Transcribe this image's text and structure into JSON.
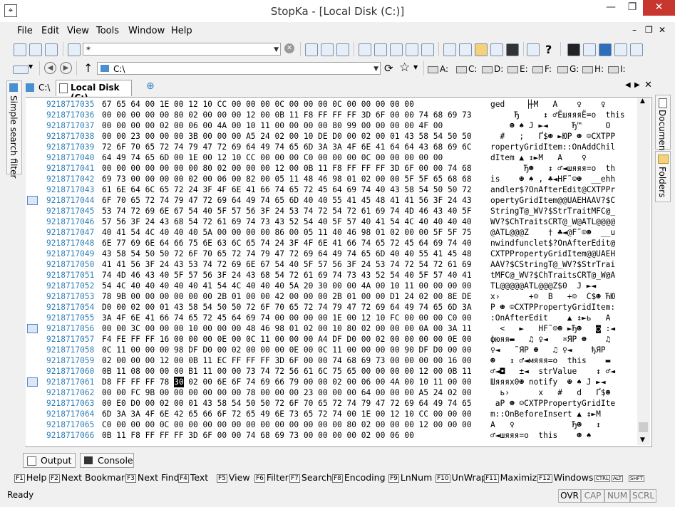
{
  "window": {
    "title": "StopKa - [Local Disk (C:)]"
  },
  "menu": [
    "File",
    "Edit",
    "View",
    "Tools",
    "Window",
    "Help"
  ],
  "toolbar1": {
    "filter_value": "*"
  },
  "toolbar2": {
    "path_value": "C:\\",
    "drives": [
      "A:",
      "C:",
      "D:",
      "E:",
      "F:",
      "G:",
      "H:",
      "I:"
    ]
  },
  "tabs": [
    {
      "label": "C:\\"
    },
    {
      "label": "Local Disk (C:)"
    }
  ],
  "side": {
    "left_panel": "Simple search filter",
    "right_panels": [
      "Document",
      "Folders"
    ]
  },
  "hex": {
    "rows": [
      {
        "offset": "9218717035",
        "hex": "67 65 64 00 1E 00 12 10 CC 00 00 00 0C 00 00 00 0C 00 00 00 00 00",
        "text": "ged    ▕┼M   A    ♀    ♀"
      },
      {
        "offset": "9218717036",
        "hex": "00 00 00 00 00 80 02 00 00 00 12 00 0B 11 F8 FF FF FF 3D 6F 00 00 74 68 69 73",
        "text": "     Ђ     ↕ ♂ЁшяяяЁ=o  this"
      },
      {
        "offset": "9218717037",
        "hex": "00 00 00 00 02 00 06 00 4A 00 10 11 00 00 00 00 80 99 00 00 00 00 4F 00",
        "text": "    ☻ ♠ J ►◄     Ђ™     O"
      },
      {
        "offset": "9218717038",
        "hex": "00 00 23 00 00 00 3B 00 00 00 A5 24 02 00 10 DE D0 00 02 00 01 43 58 54 50 50",
        "text": "  #   ;   Ґ$☻ ►ЮР ☻ ☺CXTPP"
      },
      {
        "offset": "9218717039",
        "hex": "72 6F 70 65 72 74 79 47 72 69 64 49 74 65 6D 3A 3A 4F 6E 41 64 64 43 68 69 6C",
        "text": "ropertyGridItem::OnAddChil"
      },
      {
        "offset": "9218717040",
        "hex": "64 49 74 65 6D 00 1E 00 12 10 CC 00 00 00 C0 00 00 00 0C 00 00 00 00 00",
        "text": "dItem ▲ ↕►M   A    ♀"
      },
      {
        "offset": "9218717041",
        "hex": "00 00 00 00 00 00 00 80 02 00 00 00 12 00 0B 11 F8 FF FF FF 3D 6F 00 00 74 68",
        "text": "       Ђ☻   ↕ ♂◄шяяя=o  th"
      },
      {
        "offset": "9218717042",
        "hex": "69 73 00 00 00 00 02 00 06 00 82 00 05 11 48 46 98 01 02 00 00 5F 5F 65 68 68",
        "text": "is    ☻ ♠ ‚ ♣◄HF˜☺☻  __ehh"
      },
      {
        "offset": "9218717043",
        "hex": "61 6E 64 6C 65 72 24 3F 4F 6E 41 66 74 65 72 45 64 69 74 40 43 58 54 50 50 72",
        "text": "andler$?OnAfterEdit@CXTPPr"
      },
      {
        "offset": "9218717044",
        "hex": "6F 70 65 72 74 79 47 72 69 64 49 74 65 6D 40 40 55 41 45 48 41 41 56 3F 24 43",
        "text": "opertyGridItem@@UAEHAAV?$C"
      },
      {
        "offset": "9218717045",
        "hex": "53 74 72 69 6E 67 54 40 5F 57 56 3F 24 53 74 72 54 72 61 69 74 4D 46 43 40 5F",
        "text": "StringT@_WV?$StrTraitMFC@_"
      },
      {
        "offset": "9218717046",
        "hex": "57 56 3F 24 43 68 54 72 61 69 74 73 43 52 54 40 5F 57 40 41 54 4C 40 40 40 40",
        "text": "WV?$ChTraitsCRT@_W@ATL@@@@"
      },
      {
        "offset": "9218717047",
        "hex": "40 41 54 4C 40 40 40 5A 00 00 00 00 86 00 05 11 40 46 98 01 02 00 00 5F 5F 75",
        "text": "@ATL@@@Z    † ♣◄@F˜☺☻  __u"
      },
      {
        "offset": "9218717048",
        "hex": "6E 77 69 6E 64 66 75 6E 63 6C 65 74 24 3F 4F 6E 41 66 74 65 72 45 64 69 74 40",
        "text": "nwindfunclet$?OnAfterEdit@"
      },
      {
        "offset": "9218717049",
        "hex": "43 58 54 50 50 72 6F 70 65 72 74 79 47 72 69 64 49 74 65 6D 40 40 55 41 45 48",
        "text": "CXTPPropertyGridItem@@UAEH"
      },
      {
        "offset": "9218717050",
        "hex": "41 41 56 3F 24 43 53 74 72 69 6E 67 54 40 5F 57 56 3F 24 53 74 72 54 72 61 69",
        "text": "AAV?$CStringT@_WV?$StrTrai"
      },
      {
        "offset": "9218717051",
        "hex": "74 4D 46 43 40 5F 57 56 3F 24 43 68 54 72 61 69 74 73 43 52 54 40 5F 57 40 41",
        "text": "tMFC@_WV?$ChTraitsCRT@_W@A"
      },
      {
        "offset": "9218717052",
        "hex": "54 4C 40 40 40 40 40 41 54 4C 40 40 40 5A 20 30 00 00 4A 00 10 11 00 00 00 00",
        "text": "TL@@@@@ATL@@@Z$0  J ►◄"
      },
      {
        "offset": "9218717053",
        "hex": "78 9B 00 00 00 00 00 00 2B 01 00 00 42 00 00 00 2B 01 00 00 D1 24 02 00 8E DE",
        "text": "x›      +☺  B   +☺  С$☻ ЋЮ"
      },
      {
        "offset": "9218717054",
        "hex": "D0 00 02 00 01 43 58 54 50 50 72 6F 70 65 72 74 79 47 72 69 64 49 74 65 6D 3A",
        "text": "Р ☻ ☺CXTPPropertyGridItem:"
      },
      {
        "offset": "9218717055",
        "hex": "3A 4F 6E 41 66 74 65 72 45 64 69 74 00 00 00 00 1E 00 12 10 FC 00 00 00 C0 00",
        "text": ":OnAfterEdit    ▲ ↕►ь   A"
      },
      {
        "offset": "9218717056",
        "hex": "00 00 3C 00 00 00 10 00 00 00 48 46 98 01 02 00 10 80 02 00 00 00 0A 00 3A 11",
        "text": "  <   ►   HF˜☺☻ ►Ђ☻   ◙ :◄"
      },
      {
        "offset": "9218717057",
        "hex": "F4 FE FF FF 16 00 00 00 0E 00 0C 11 00 00 00 A4 DF D0 00 02 00 00 00 00 0E 00",
        "text": "фюяя▬   ♫ ♀◄   ¤ЯР ☻    ♫"
      },
      {
        "offset": "9218717058",
        "hex": "0C 11 00 00 00 98 DF D0 00 02 00 00 00 0E 00 0C 11 00 00 00 00 90 DF D0 00 00",
        "text": "♀◄   ˜ЯР ☻   ♫ ♀◄    ђЯР"
      },
      {
        "offset": "9218717059",
        "hex": "02 00 00 00 12 00 0B 11 EC FF FF FF 3D 6F 00 00 74 68 69 73 00 00 00 00 16 00",
        "text": "☻   ↕ ♂◄мяяя=o  this    ▬"
      },
      {
        "offset": "9218717060",
        "hex": "0B 11 08 00 00 00 B1 11 00 00 73 74 72 56 61 6C 75 65 00 00 00 00 12 00 0B 11",
        "text": "♂◄◘   ±◄  strValue    ↕ ♂◄"
      },
      {
        "offset": "9218717061",
        "hex": "D8 FF FF FF 78 30 02 00 6E 6F 74 69 66 79 00 00 02 00 06 00 4A 00 10 11 00 00",
        "text": "Шяяяx0☻ notify  ☻ ♠ J ►◄"
      },
      {
        "offset": "9218717062",
        "hex": "00 00 FC 9B 00 00 00 00 00 00 78 00 00 00 23 00 00 00 64 00 00 00 A5 24 02 00",
        "text": "  ь›      x   #   d   Ґ$☻"
      },
      {
        "offset": "9218717063",
        "hex": "00 E0 D0 00 02 00 01 43 58 54 50 50 72 6F 70 65 72 74 79 47 72 69 64 49 74 65",
        "text": " аР ☻ ☺CXTPPropertyGridIte"
      },
      {
        "offset": "9218717064",
        "hex": "6D 3A 3A 4F 6E 42 65 66 6F 72 65 49 6E 73 65 72 74 00 1E 00 12 10 CC 00 00 00",
        "text": "m::OnBeforeInsert ▲ ↕►M"
      },
      {
        "offset": "9218717065",
        "hex": "C0 00 00 00 0C 00 00 00 00 00 00 00 00 00 00 00 00 80 02 00 00 00 12 00 00 00",
        "text": "A   ♀            Ђ☻   ↕"
      },
      {
        "offset": "9218717066",
        "hex": "0B 11 F8 FF FF FF 3D 6F 00 00 74 68 69 73 00 00 00 00 02 00 06 00",
        "text": "♂◄шяяя=o  this    ☻ ♠"
      }
    ],
    "bookmark_rows": [
      9,
      21,
      26
    ],
    "cursor": {
      "row": 26,
      "byte": 5,
      "text": "30"
    }
  },
  "bottom_tabs": [
    "Output",
    "Console"
  ],
  "fkeys": [
    {
      "key": "F1",
      "label": "Help"
    },
    {
      "key": "F2",
      "label": "Next Bookmark"
    },
    {
      "key": "F3",
      "label": "Next Find"
    },
    {
      "key": "F4",
      "label": "Text"
    },
    {
      "key": "F5",
      "label": "View"
    },
    {
      "key": "F6",
      "label": "Filter"
    },
    {
      "key": "F7",
      "label": "Search"
    },
    {
      "key": "F8",
      "label": "Encoding"
    },
    {
      "key": "F9",
      "label": "LnNum"
    },
    {
      "key": "F10",
      "label": "UnWrap"
    },
    {
      "key": "F11",
      "label": "Maximize"
    },
    {
      "key": "F12",
      "label": "Windows"
    }
  ],
  "modifier_keys": [
    "CTRL",
    "ALT",
    "SHFT"
  ],
  "status": {
    "text": "Ready",
    "indicators": [
      "OVR",
      "CAP",
      "NUM",
      "SCRL"
    ]
  }
}
